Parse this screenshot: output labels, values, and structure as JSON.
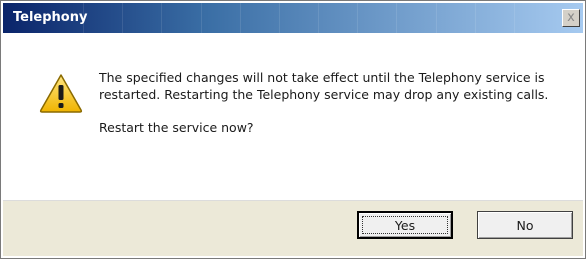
{
  "window": {
    "title": "Telephony",
    "close_glyph": "x",
    "close_icon": "close-icon"
  },
  "content": {
    "icon": "warning-icon",
    "message": "The specified changes will not take effect until the Telephony service is restarted.  Restarting the Telephony service may drop any existing calls.",
    "question": "Restart the service now?"
  },
  "buttons": {
    "yes_label": "Yes",
    "no_label": "No"
  },
  "colors": {
    "titlebar_start": "#0a246a",
    "titlebar_end": "#a6caf0",
    "footer_bg": "#ece9d8",
    "warning_yellow": "#f5c800"
  }
}
